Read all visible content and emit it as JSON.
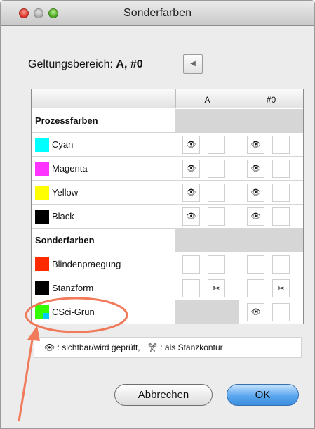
{
  "window": {
    "title": "Sonderfarben"
  },
  "scope": {
    "label": "Geltungsbereich:",
    "value": "A, #0",
    "button_glyph": "◀"
  },
  "table": {
    "columns": [
      "A",
      "#0"
    ],
    "groups": [
      {
        "label": "Prozessfarben"
      },
      {
        "label": "Sonderfarben"
      }
    ],
    "rows": [
      {
        "label": "Cyan",
        "swatch": "#00ffff",
        "a_icon": "👁",
        "a_icon2": "",
        "z_icon": "👁",
        "z_icon2": ""
      },
      {
        "label": "Magenta",
        "swatch": "#ff33ff",
        "a_icon": "👁",
        "a_icon2": "",
        "z_icon": "👁",
        "z_icon2": ""
      },
      {
        "label": "Yellow",
        "swatch": "#ffff00",
        "a_icon": "👁",
        "a_icon2": "",
        "z_icon": "👁",
        "z_icon2": ""
      },
      {
        "label": "Black",
        "swatch": "#000000",
        "a_icon": "👁",
        "a_icon2": "",
        "z_icon": "👁",
        "z_icon2": ""
      },
      {
        "label": "Blindenpraegung",
        "swatch": "#ff2a00",
        "a_icon": "",
        "a_icon2": "",
        "z_icon": "",
        "z_icon2": ""
      },
      {
        "label": "Stanzform",
        "swatch": "#000000",
        "a_icon": "",
        "a_icon2": "✂",
        "z_icon": "",
        "z_icon2": "✂"
      },
      {
        "label": "CSci-Grün",
        "swatch": "#33ff00",
        "swatch_inner": "#00ccff",
        "a_icon": "",
        "a_icon2": "",
        "z_icon": "👁",
        "z_icon2": ""
      }
    ]
  },
  "legend": {
    "eye_text": ": sichtbar/wird geprüft,",
    "scissor_text": ": als Stanzkontur",
    "eye_glyph": "👁",
    "scissor_glyph": "✂"
  },
  "buttons": {
    "cancel": "Abbrechen",
    "ok": "OK"
  },
  "annotation": {
    "color": "#f07a5a"
  }
}
